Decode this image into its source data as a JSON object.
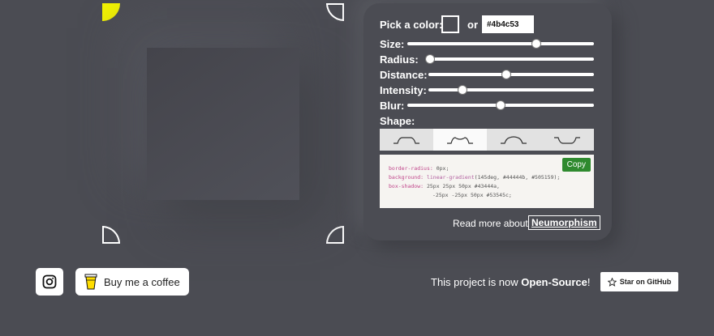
{
  "colors": {
    "background": "#4b4c53",
    "active_corner": "#f4f400",
    "copy_button": "#2f8a2f"
  },
  "corners": [
    "top-left-active",
    "top-right",
    "bottom-left",
    "bottom-right"
  ],
  "panel": {
    "pick_color_label": "Pick a color:",
    "or_label": "or",
    "hex_value": "#4b4c53",
    "sliders": [
      {
        "label": "Size:",
        "value_fraction": 0.7
      },
      {
        "label": "Radius:",
        "value_fraction": 0.0
      },
      {
        "label": "Distance:",
        "value_fraction": 0.47
      },
      {
        "label": "Intensity:",
        "value_fraction": 0.19
      },
      {
        "label": "Blur:",
        "value_fraction": 0.5
      }
    ],
    "shape_label": "Shape:",
    "shapes": [
      "flat",
      "concave",
      "convex",
      "pressed"
    ],
    "active_shape": "concave",
    "code": {
      "line1_prop": "border-radius:",
      "line1_val": " 0px;",
      "line2_prop": "background:",
      "line2_fn": " linear-gradient",
      "line2_val": "(145deg, #44444b, #505159);",
      "line3_prop": "box-shadow:",
      "line3_val": "  25px 25px 50px #43444a,",
      "line4_val": "-25px -25px 50px #53545c;"
    },
    "copy_label": "Copy",
    "read_more_label": "Read more about",
    "read_more_link": "Neumorphism"
  },
  "footer": {
    "instagram_icon": "instagram-icon",
    "coffee_label": "Buy me a coffee",
    "open_source_prefix": "This project is now ",
    "open_source_bold": "Open-Source",
    "open_source_suffix": "!",
    "github_label": "Star on GitHub"
  }
}
